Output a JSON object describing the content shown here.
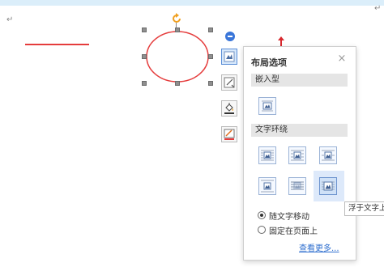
{
  "document": {
    "paragraph_mark": "↵"
  },
  "icons": {
    "rotate": "rotate-icon",
    "collapse": "collapse-minus-icon",
    "layout_options": "wrap-layout-icon",
    "crop": "crop-icon",
    "fill": "fill-bucket-icon",
    "outline": "outline-pen-icon"
  },
  "layout_panel": {
    "title": "布局选项",
    "close": "×",
    "inline_section": "嵌入型",
    "wrap_section": "文字环绕",
    "radio_move_with_text": "随文字移动",
    "radio_fix_on_page": "固定在页面上",
    "see_more": "查看更多...",
    "selected_radio": "随文字移动"
  },
  "tooltip": {
    "text": "浮于文字上方"
  },
  "colors": {
    "shape_line": "#e53c3c",
    "accent": "#3a76d9",
    "link": "#2f6fcf"
  }
}
